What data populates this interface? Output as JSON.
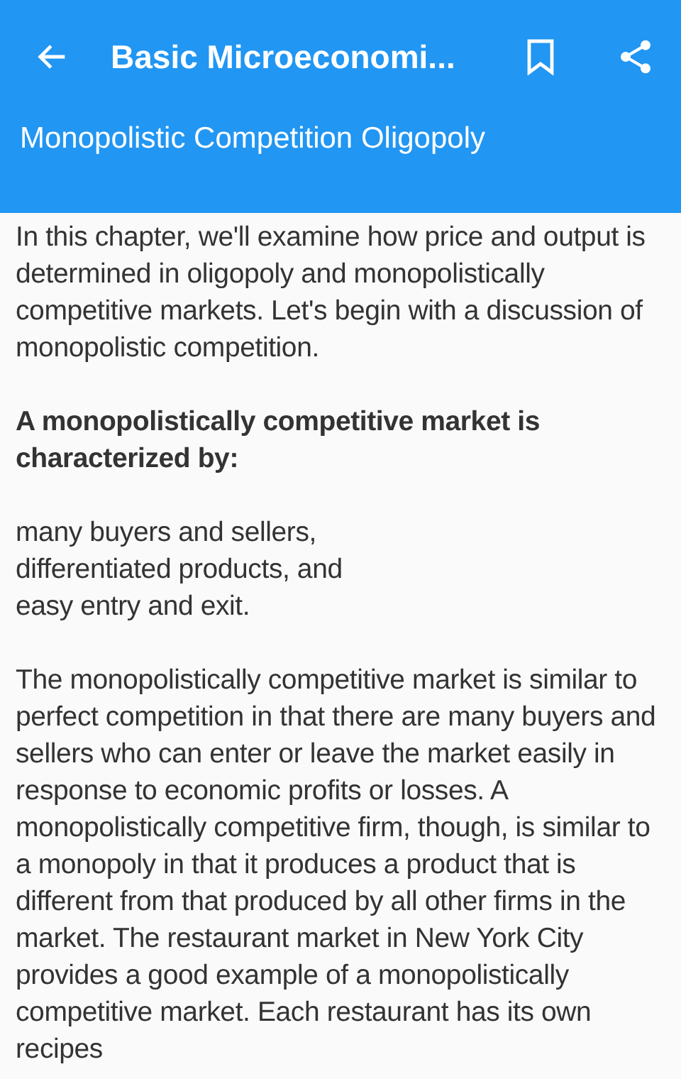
{
  "app_bar": {
    "title": "Basic Microeconomi...",
    "subtitle": "Monopolistic Competition Oligopoly"
  },
  "content": [
    {
      "kind": "paragraph",
      "text": "In this chapter, we'll examine how price and output is determined in oligopoly and monopolistically competitive markets. Let's begin with a discussion of monopolistic competition."
    },
    {
      "kind": "heading",
      "text": "A monopolistically competitive market is characterized by:"
    },
    {
      "kind": "lines",
      "lines": [
        "many buyers and sellers,",
        "differentiated products, and",
        "easy entry and exit."
      ]
    },
    {
      "kind": "paragraph",
      "text": "The monopolistically competitive market is similar to perfect competition in that there are many buyers and sellers who can enter or leave the market easily in response to economic profits or losses. A monopolistically competitive firm, though, is similar to a monopoly in that it produces a product that is different from that produced by all other firms in the market. The restaurant market in New York City provides a good example of a monopolistically competitive market. Each restaurant has its own recipes"
    }
  ]
}
